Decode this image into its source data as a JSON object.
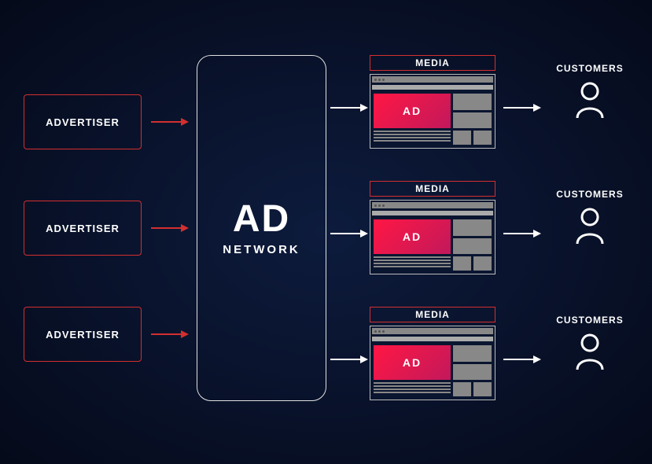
{
  "advertisers": [
    {
      "label": "ADVERTISER"
    },
    {
      "label": "ADVERTISER"
    },
    {
      "label": "ADVERTISER"
    }
  ],
  "network": {
    "title": "AD",
    "subtitle": "NETWORK"
  },
  "media": [
    {
      "label": "MEDIA",
      "ad_text": "AD"
    },
    {
      "label": "MEDIA",
      "ad_text": "AD"
    },
    {
      "label": "MEDIA",
      "ad_text": "AD"
    }
  ],
  "customers": [
    {
      "label": "CUSTOMERS"
    },
    {
      "label": "CUSTOMERS"
    },
    {
      "label": "CUSTOMERS"
    }
  ]
}
